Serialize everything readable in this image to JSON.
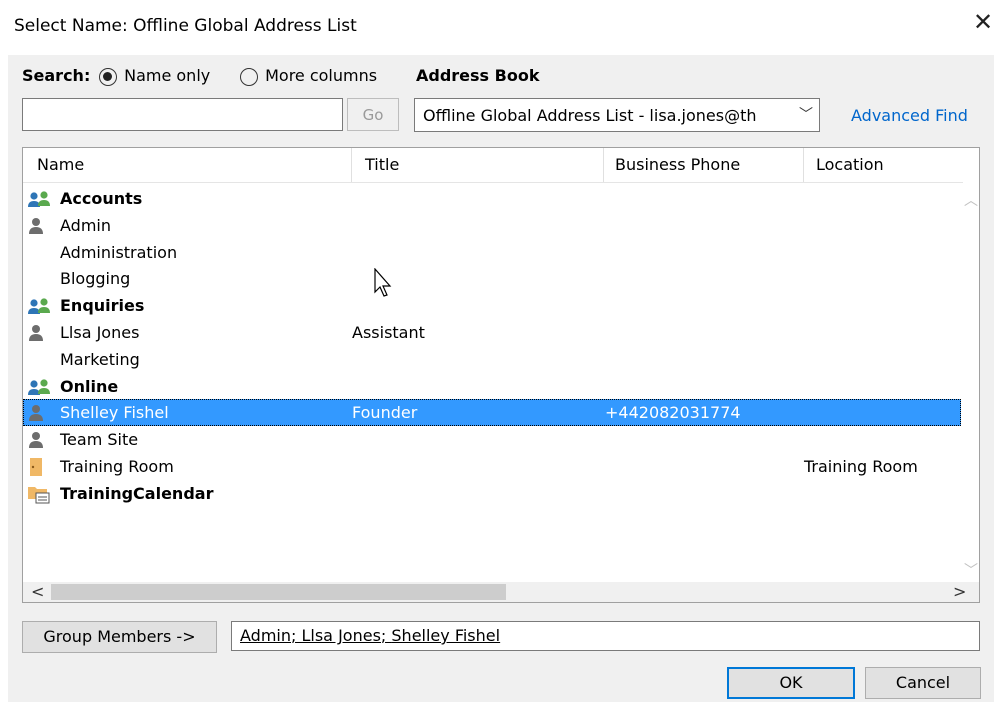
{
  "window": {
    "title": "Select Name: Offline Global Address List",
    "close_glyph": "✕"
  },
  "search": {
    "label": "Search:",
    "option_name_only": "Name only",
    "option_more_columns": "More columns",
    "selected": "Name only",
    "input_value": "",
    "go_label": "Go"
  },
  "address_book": {
    "label": "Address Book",
    "selected": "Offline Global Address List - lisa.jones@th",
    "advanced_find": "Advanced Find"
  },
  "table": {
    "columns": [
      "Name",
      "Title",
      "Business Phone",
      "Location"
    ],
    "rows": [
      {
        "name": "Accounts",
        "title": "",
        "phone": "",
        "location": "",
        "icon": "group-icon",
        "bold": true,
        "selected": false
      },
      {
        "name": "Admin",
        "title": "",
        "phone": "",
        "location": "",
        "icon": "person-icon",
        "bold": false,
        "selected": false
      },
      {
        "name": "Administration",
        "title": "",
        "phone": "",
        "location": "",
        "icon": "",
        "bold": false,
        "selected": false
      },
      {
        "name": "Blogging",
        "title": "",
        "phone": "",
        "location": "",
        "icon": "",
        "bold": false,
        "selected": false
      },
      {
        "name": "Enquiries",
        "title": "",
        "phone": "",
        "location": "",
        "icon": "group-icon",
        "bold": true,
        "selected": false
      },
      {
        "name": "Llsa Jones",
        "title": "Assistant",
        "phone": "",
        "location": "",
        "icon": "person-icon",
        "bold": false,
        "selected": false
      },
      {
        "name": "Marketing",
        "title": "",
        "phone": "",
        "location": "",
        "icon": "",
        "bold": false,
        "selected": false
      },
      {
        "name": "Online",
        "title": "",
        "phone": "",
        "location": "",
        "icon": "group-icon",
        "bold": true,
        "selected": false
      },
      {
        "name": "Shelley Fishel",
        "title": "Founder",
        "phone": "+442082031774",
        "location": "",
        "icon": "person-icon",
        "bold": false,
        "selected": true
      },
      {
        "name": "Team Site",
        "title": "",
        "phone": "",
        "location": "",
        "icon": "person-icon",
        "bold": false,
        "selected": false
      },
      {
        "name": "Training Room",
        "title": "",
        "phone": "",
        "location": "Training Room",
        "icon": "room-icon",
        "bold": false,
        "selected": false
      },
      {
        "name": "TrainingCalendar",
        "title": "",
        "phone": "",
        "location": "",
        "icon": "calendar-folder-icon",
        "bold": true,
        "selected": false
      }
    ]
  },
  "group_members": {
    "button_label": "Group Members ->",
    "members": [
      "Admin",
      "Llsa Jones",
      "Shelley Fishel"
    ],
    "separator": "; "
  },
  "buttons": {
    "ok": "OK",
    "cancel": "Cancel"
  },
  "colors": {
    "selection": "#3399ff",
    "link": "#0066cc",
    "group_icon_blue": "#2e75b6",
    "group_icon_green": "#5aa94e",
    "person_icon": "#6d6d6d",
    "room_icon": "#f0b866"
  }
}
